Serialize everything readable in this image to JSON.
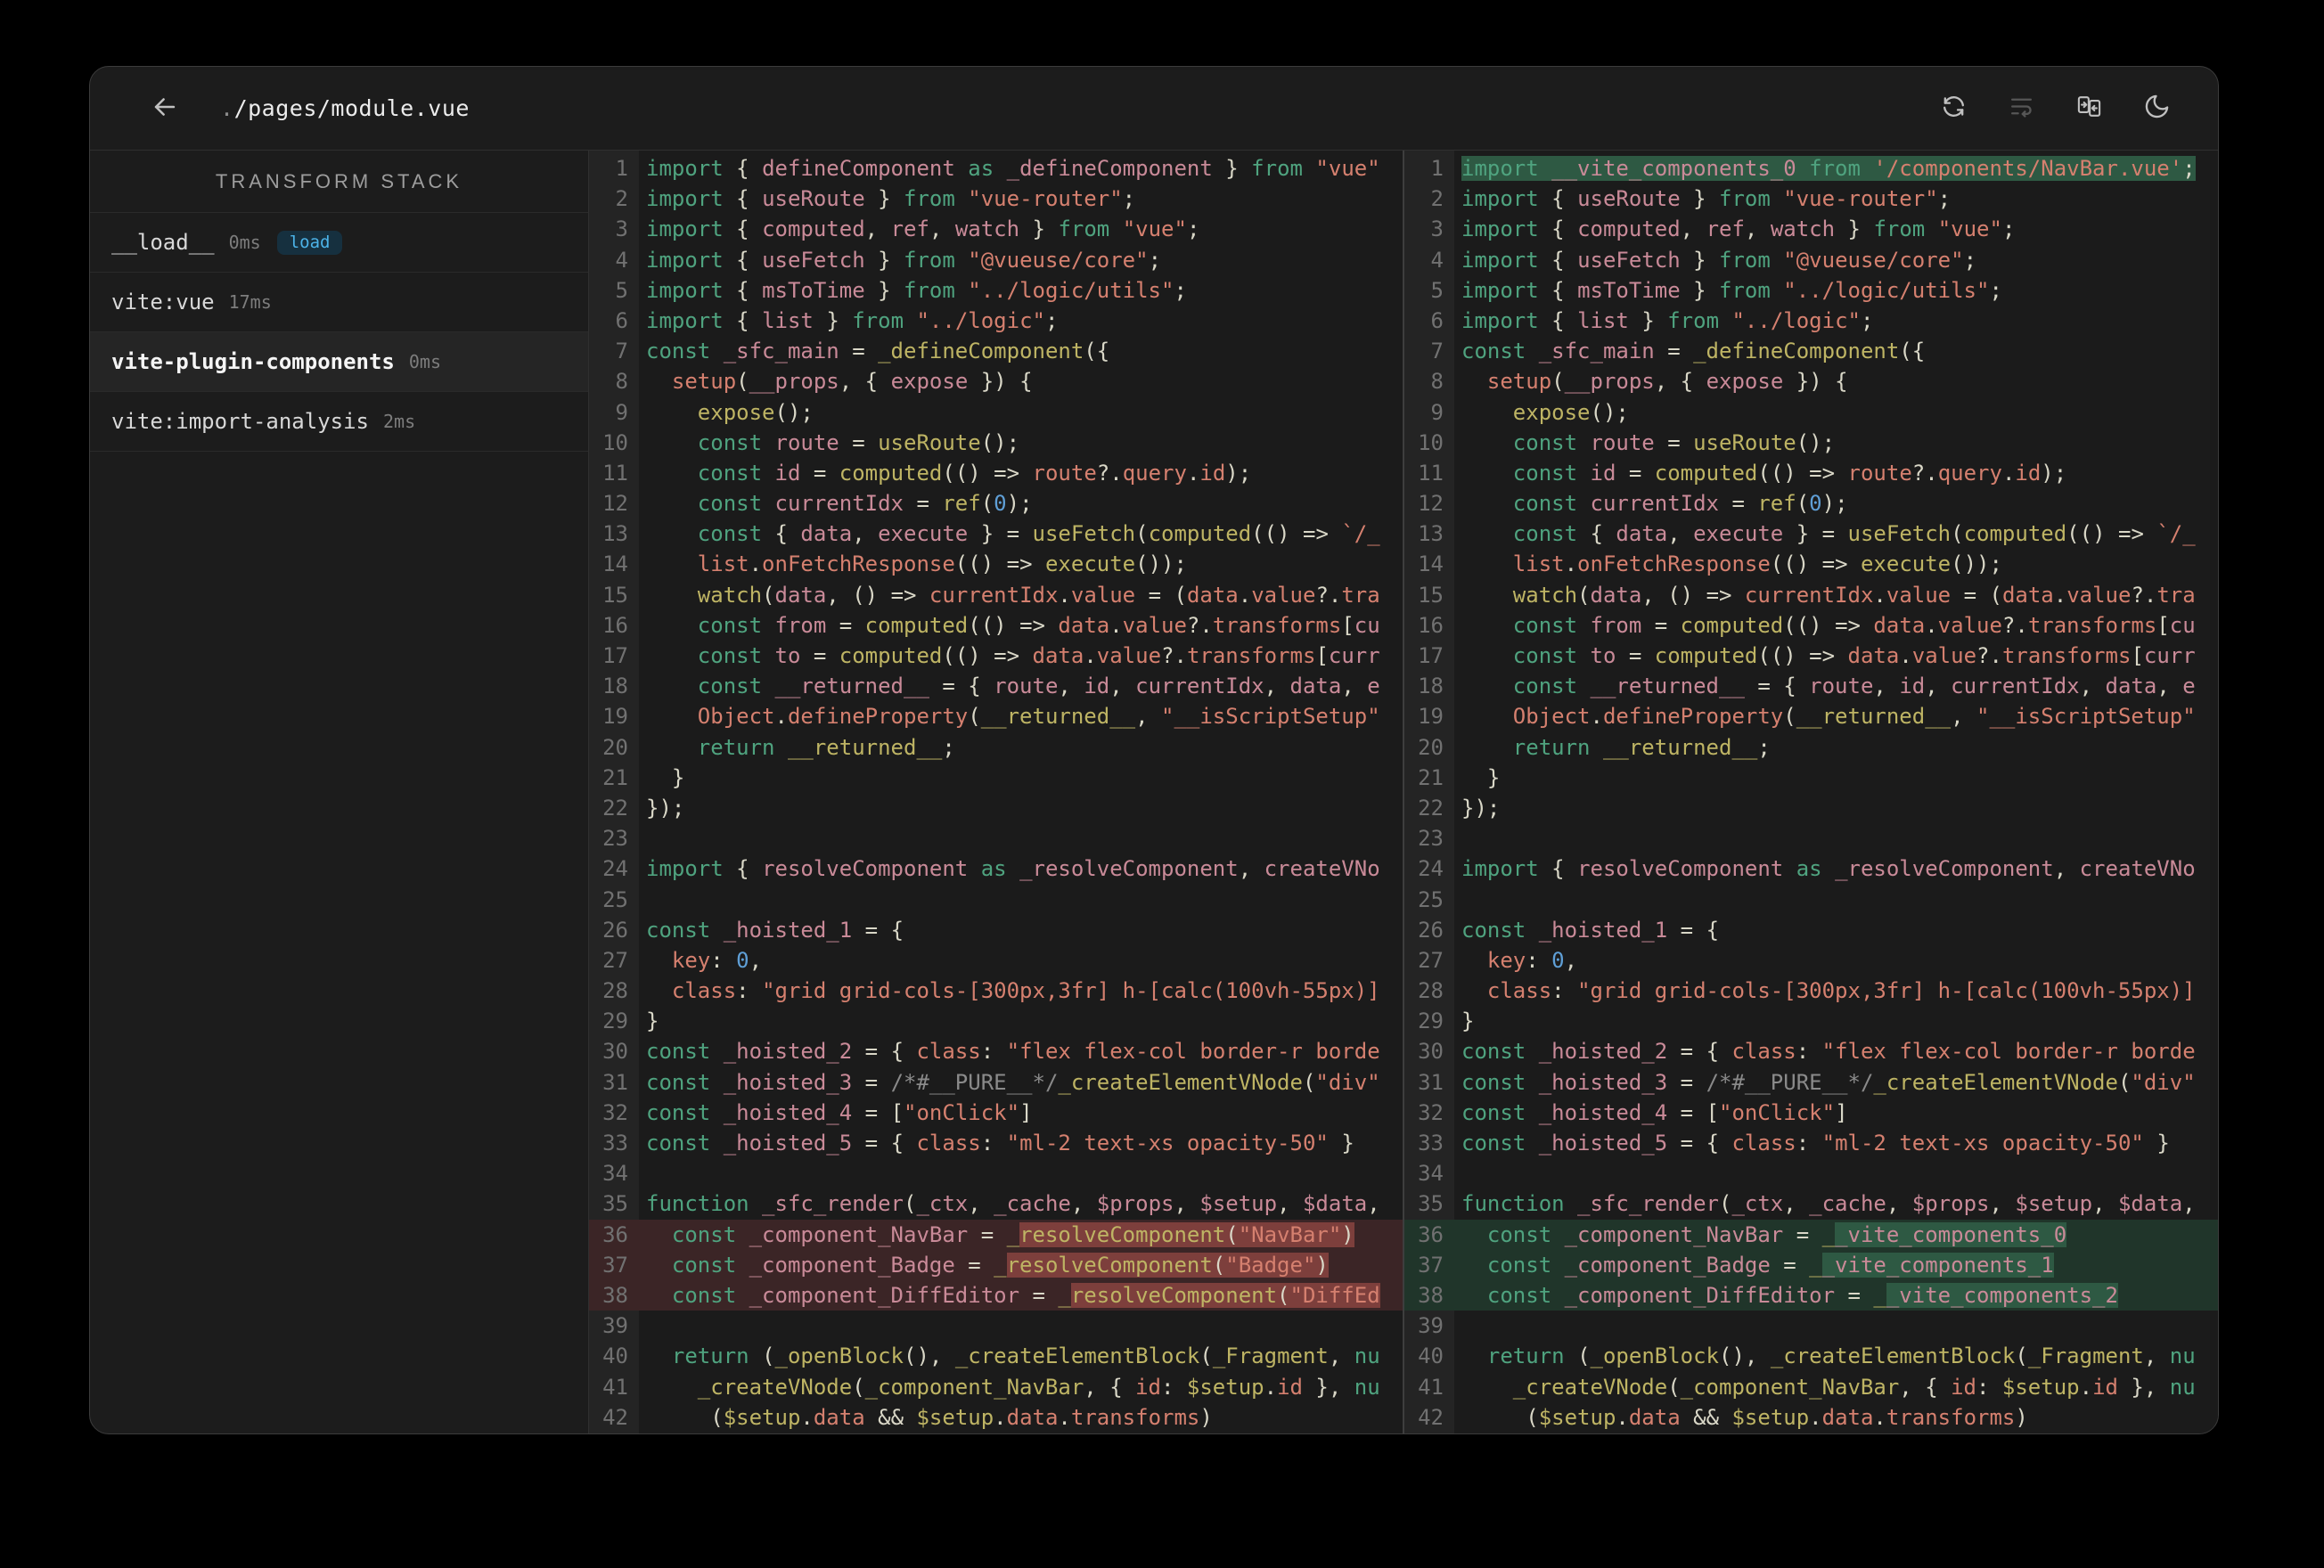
{
  "colors": {
    "background": "#000000",
    "window": "#1c1c1c",
    "accent_badge": "#4cb3e8",
    "keyword": "#4fa37f",
    "variable": "#c98a98",
    "string": "#d5806f",
    "function": "#beb464",
    "number": "#5f9fd6",
    "removed_line": "#3b2526",
    "removed_word": "#7d3f3c",
    "added_line": "#20352a",
    "added_word": "#2e5943"
  },
  "titlebar": {
    "back_icon": "arrow-left",
    "title_dot": ".",
    "title_path": "/pages/module.vue",
    "icons": [
      "refresh-icon",
      "line-wrap-icon",
      "compare-panels-icon",
      "moon-icon"
    ]
  },
  "sidebar": {
    "header": "TRANSFORM STACK",
    "items": [
      {
        "name": "__load__",
        "time": "0ms",
        "badge": "load",
        "selected": false
      },
      {
        "name": "vite:vue",
        "time": "17ms",
        "badge": null,
        "selected": false
      },
      {
        "name": "vite-plugin-components",
        "time": "0ms",
        "badge": null,
        "selected": true
      },
      {
        "name": "vite:import-analysis",
        "time": "2ms",
        "badge": null,
        "selected": false
      }
    ]
  },
  "editors": {
    "left": {
      "lines": [
        {
          "n": 1,
          "t": "import { defineComponent as _defineComponent } from \"vue\""
        },
        {
          "n": 2,
          "t": "import { useRoute } from \"vue-router\";"
        },
        {
          "n": 3,
          "t": "import { computed, ref, watch } from \"vue\";"
        },
        {
          "n": 4,
          "t": "import { useFetch } from \"@vueuse/core\";"
        },
        {
          "n": 5,
          "t": "import { msToTime } from \"../logic/utils\";"
        },
        {
          "n": 6,
          "t": "import { list } from \"../logic\";"
        },
        {
          "n": 7,
          "t": "const _sfc_main = _defineComponent({"
        },
        {
          "n": 8,
          "t": "  setup(__props, { expose }) {"
        },
        {
          "n": 9,
          "t": "    expose();"
        },
        {
          "n": 10,
          "t": "    const route = useRoute();"
        },
        {
          "n": 11,
          "t": "    const id = computed(() => route?.query.id);"
        },
        {
          "n": 12,
          "t": "    const currentIdx = ref(0);"
        },
        {
          "n": 13,
          "t": "    const { data, execute } = useFetch(computed(() => `/_"
        },
        {
          "n": 14,
          "t": "    list.onFetchResponse(() => execute());"
        },
        {
          "n": 15,
          "t": "    watch(data, () => currentIdx.value = (data.value?.tra"
        },
        {
          "n": 16,
          "t": "    const from = computed(() => data.value?.transforms[cu"
        },
        {
          "n": 17,
          "t": "    const to = computed(() => data.value?.transforms[curr"
        },
        {
          "n": 18,
          "t": "    const __returned__ = { route, id, currentIdx, data, e"
        },
        {
          "n": 19,
          "t": "    Object.defineProperty(__returned__, \"__isScriptSetup\""
        },
        {
          "n": 20,
          "t": "    return __returned__;"
        },
        {
          "n": 21,
          "t": "  }"
        },
        {
          "n": 22,
          "t": "});"
        },
        {
          "n": 23,
          "t": ""
        },
        {
          "n": 24,
          "t": "import { resolveComponent as _resolveComponent, createVNo"
        },
        {
          "n": 25,
          "t": ""
        },
        {
          "n": 26,
          "t": "const _hoisted_1 = {"
        },
        {
          "n": 27,
          "t": "  key: 0,"
        },
        {
          "n": 28,
          "t": "  class: \"grid grid-cols-[300px,3fr] h-[calc(100vh-55px)]"
        },
        {
          "n": 29,
          "t": "}"
        },
        {
          "n": 30,
          "t": "const _hoisted_2 = { class: \"flex flex-col border-r borde"
        },
        {
          "n": 31,
          "t": "const _hoisted_3 = /*#__PURE__*/_createElementVNode(\"div\""
        },
        {
          "n": 32,
          "t": "const _hoisted_4 = [\"onClick\"]"
        },
        {
          "n": 33,
          "t": "const _hoisted_5 = { class: \"ml-2 text-xs opacity-50\" }"
        },
        {
          "n": 34,
          "t": ""
        },
        {
          "n": 35,
          "t": "function _sfc_render(_ctx, _cache, $props, $setup, $data,"
        },
        {
          "n": 36,
          "t": "  const _component_NavBar = _resolveComponent(\"NavBar\")",
          "diff": "removed",
          "mark": "resolveComponent(\"NavBar\")"
        },
        {
          "n": 37,
          "t": "  const _component_Badge = _resolveComponent(\"Badge\")",
          "diff": "removed",
          "mark": "resolveComponent(\"Badge\")"
        },
        {
          "n": 38,
          "t": "  const _component_DiffEditor = _resolveComponent(\"DiffEd",
          "diff": "removed",
          "mark": "resolveComponent(\"DiffEd"
        },
        {
          "n": 39,
          "t": ""
        },
        {
          "n": 40,
          "t": "  return (_openBlock(), _createElementBlock(_Fragment, nu"
        },
        {
          "n": 41,
          "t": "    _createVNode(_component_NavBar, { id: $setup.id }, nu"
        },
        {
          "n": 42,
          "t": "     ($setup.data && $setup.data.transforms)"
        }
      ]
    },
    "right": {
      "lines": [
        {
          "n": 1,
          "t": "import __vite_components_0 from '/components/NavBar.vue';",
          "diff": "added",
          "row": false,
          "mark": "import __vite_components_0 from '/components/NavBar.vue';"
        },
        {
          "n": 2,
          "t": "import { useRoute } from \"vue-router\";"
        },
        {
          "n": 3,
          "t": "import { computed, ref, watch } from \"vue\";"
        },
        {
          "n": 4,
          "t": "import { useFetch } from \"@vueuse/core\";"
        },
        {
          "n": 5,
          "t": "import { msToTime } from \"../logic/utils\";"
        },
        {
          "n": 6,
          "t": "import { list } from \"../logic\";"
        },
        {
          "n": 7,
          "t": "const _sfc_main = _defineComponent({"
        },
        {
          "n": 8,
          "t": "  setup(__props, { expose }) {"
        },
        {
          "n": 9,
          "t": "    expose();"
        },
        {
          "n": 10,
          "t": "    const route = useRoute();"
        },
        {
          "n": 11,
          "t": "    const id = computed(() => route?.query.id);"
        },
        {
          "n": 12,
          "t": "    const currentIdx = ref(0);"
        },
        {
          "n": 13,
          "t": "    const { data, execute } = useFetch(computed(() => `/_"
        },
        {
          "n": 14,
          "t": "    list.onFetchResponse(() => execute());"
        },
        {
          "n": 15,
          "t": "    watch(data, () => currentIdx.value = (data.value?.tra"
        },
        {
          "n": 16,
          "t": "    const from = computed(() => data.value?.transforms[cu"
        },
        {
          "n": 17,
          "t": "    const to = computed(() => data.value?.transforms[curr"
        },
        {
          "n": 18,
          "t": "    const __returned__ = { route, id, currentIdx, data, e"
        },
        {
          "n": 19,
          "t": "    Object.defineProperty(__returned__, \"__isScriptSetup\""
        },
        {
          "n": 20,
          "t": "    return __returned__;"
        },
        {
          "n": 21,
          "t": "  }"
        },
        {
          "n": 22,
          "t": "});"
        },
        {
          "n": 23,
          "t": ""
        },
        {
          "n": 24,
          "t": "import { resolveComponent as _resolveComponent, createVNo"
        },
        {
          "n": 25,
          "t": ""
        },
        {
          "n": 26,
          "t": "const _hoisted_1 = {"
        },
        {
          "n": 27,
          "t": "  key: 0,"
        },
        {
          "n": 28,
          "t": "  class: \"grid grid-cols-[300px,3fr] h-[calc(100vh-55px)]"
        },
        {
          "n": 29,
          "t": "}"
        },
        {
          "n": 30,
          "t": "const _hoisted_2 = { class: \"flex flex-col border-r borde"
        },
        {
          "n": 31,
          "t": "const _hoisted_3 = /*#__PURE__*/_createElementVNode(\"div\""
        },
        {
          "n": 32,
          "t": "const _hoisted_4 = [\"onClick\"]"
        },
        {
          "n": 33,
          "t": "const _hoisted_5 = { class: \"ml-2 text-xs opacity-50\" }"
        },
        {
          "n": 34,
          "t": ""
        },
        {
          "n": 35,
          "t": "function _sfc_render(_ctx, _cache, $props, $setup, $data,"
        },
        {
          "n": 36,
          "t": "  const _component_NavBar = __vite_components_0",
          "diff": "added",
          "mark": "_vite_components_0"
        },
        {
          "n": 37,
          "t": "  const _component_Badge = __vite_components_1",
          "diff": "added",
          "mark": "_vite_components_1"
        },
        {
          "n": 38,
          "t": "  const _component_DiffEditor = __vite_components_2",
          "diff": "added",
          "mark": "_vite_components_2"
        },
        {
          "n": 39,
          "t": ""
        },
        {
          "n": 40,
          "t": "  return (_openBlock(), _createElementBlock(_Fragment, nu"
        },
        {
          "n": 41,
          "t": "    _createVNode(_component_NavBar, { id: $setup.id }, nu"
        },
        {
          "n": 42,
          "t": "     ($setup.data && $setup.data.transforms)"
        }
      ]
    }
  }
}
